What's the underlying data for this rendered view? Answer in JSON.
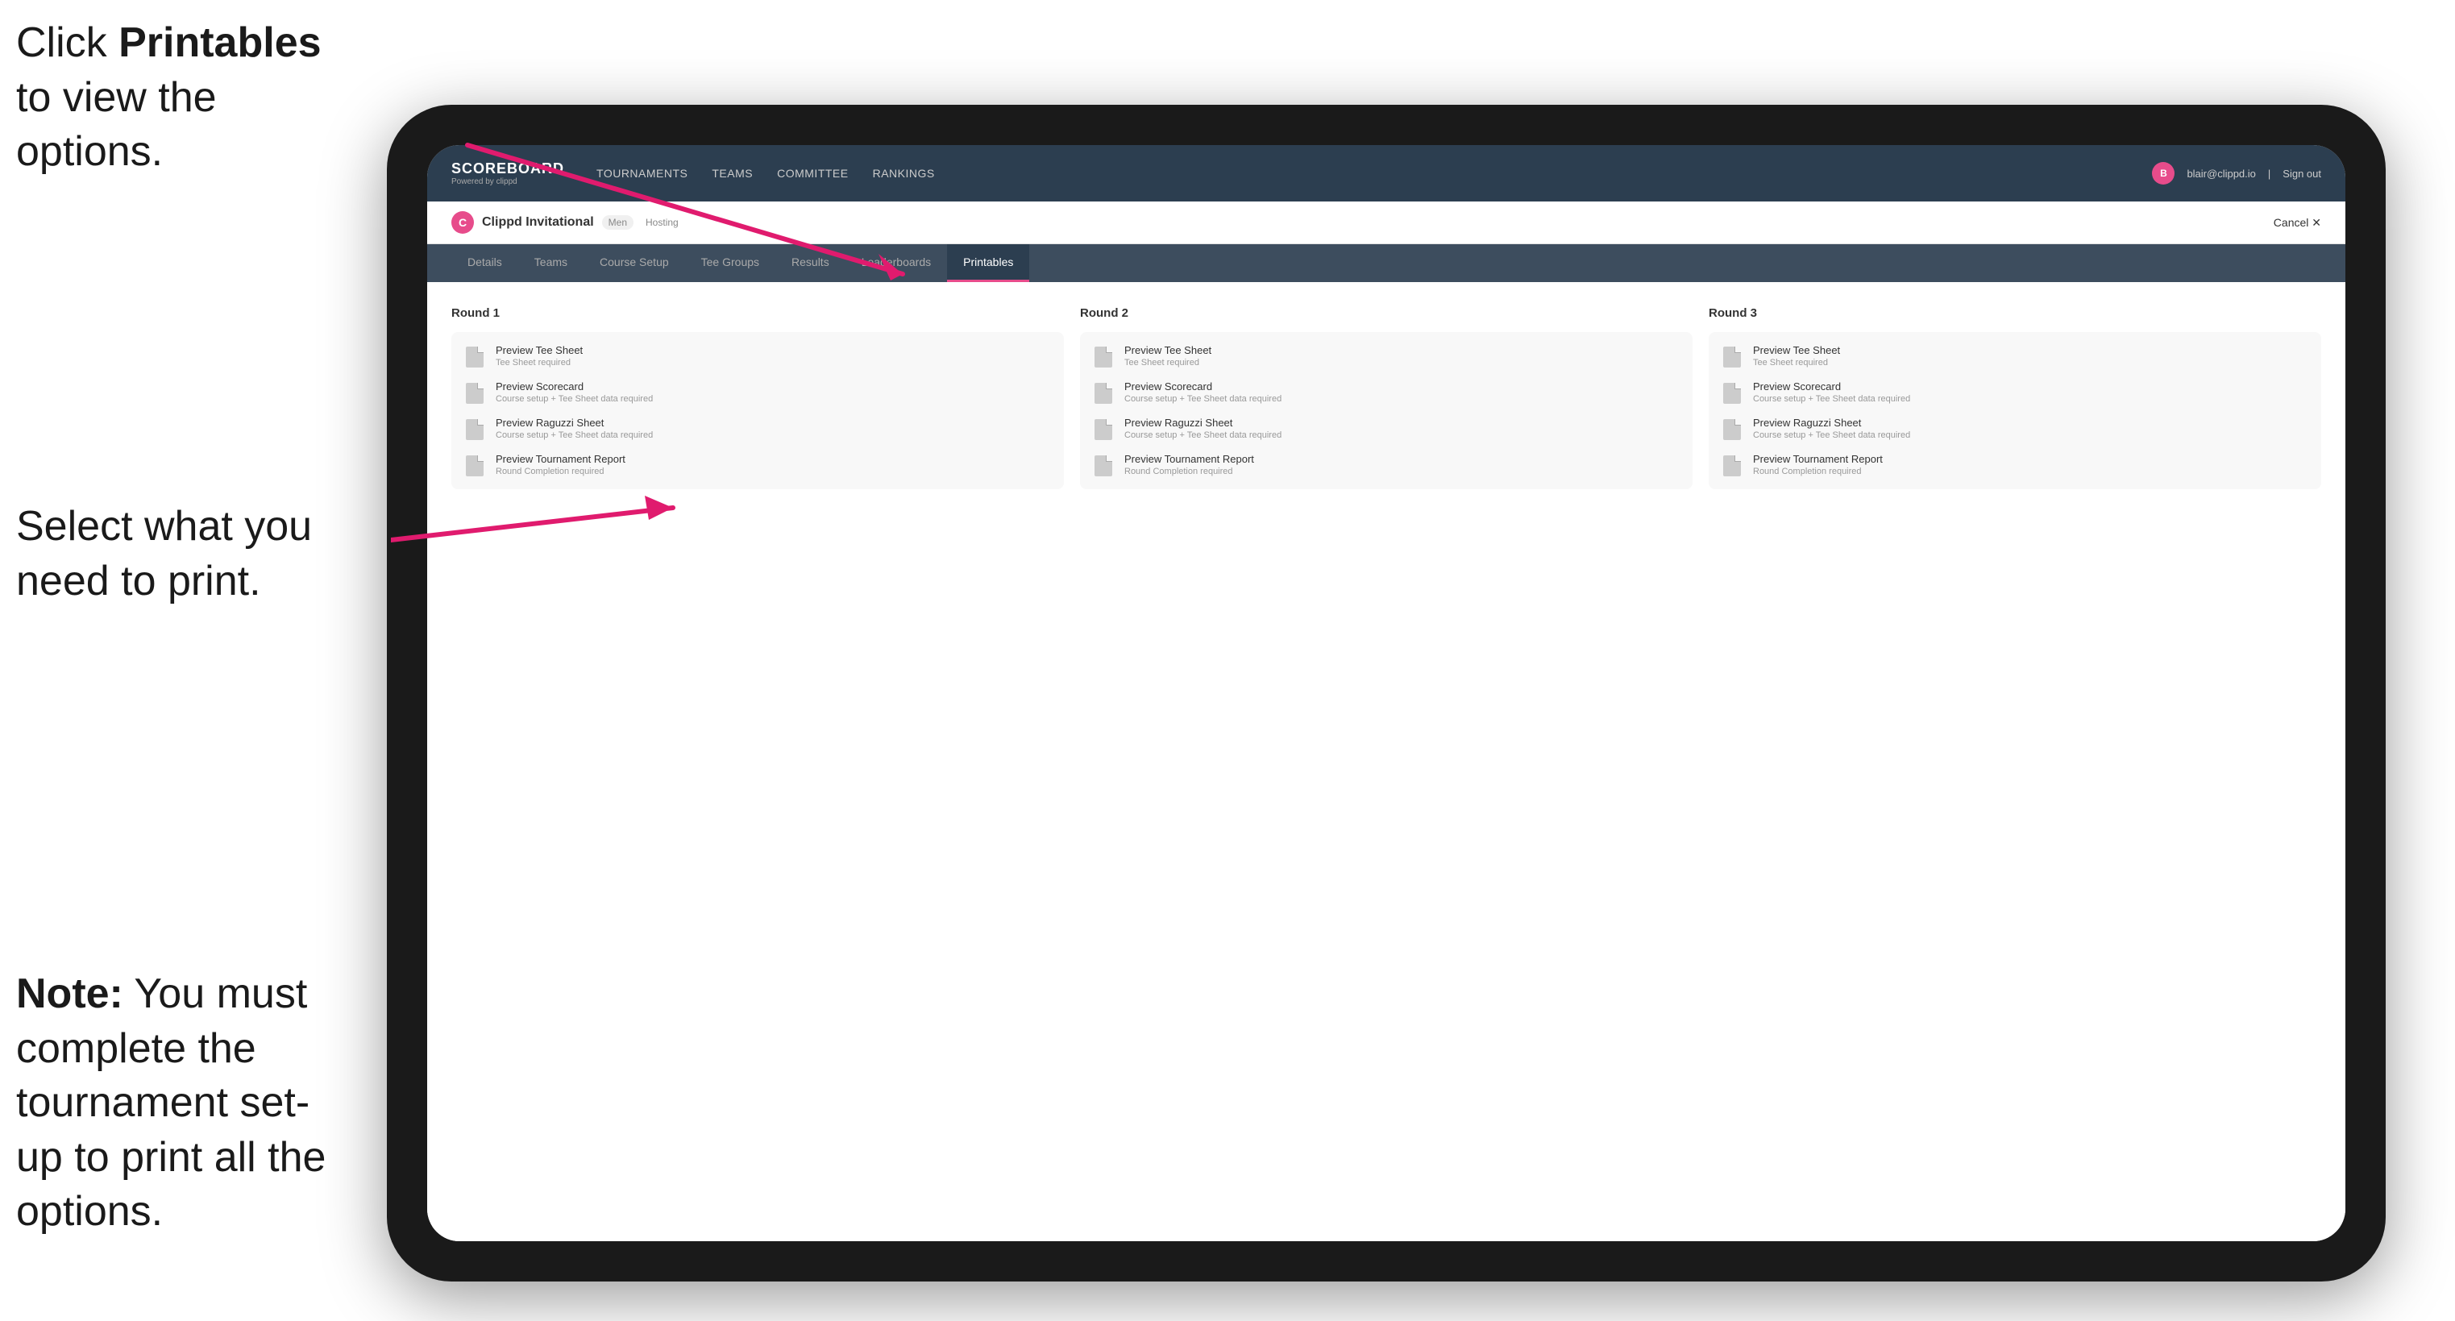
{
  "annotations": {
    "top_instruction_prefix": "Click ",
    "top_instruction_bold": "Printables",
    "top_instruction_suffix": " to view the options.",
    "mid_instruction": "Select what you need to print.",
    "bottom_note_bold": "Note:",
    "bottom_note_text": " You must complete the tournament set-up to print all the options."
  },
  "nav": {
    "logo_title": "SCOREBOARD",
    "logo_subtitle": "Powered by clippd",
    "items": [
      {
        "label": "TOURNAMENTS",
        "active": false
      },
      {
        "label": "TEAMS",
        "active": false
      },
      {
        "label": "COMMITTEE",
        "active": false
      },
      {
        "label": "RANKINGS",
        "active": false
      }
    ],
    "user_email": "blair@clippd.io",
    "sign_out": "Sign out"
  },
  "sub_header": {
    "tournament_name": "Clippd Invitational",
    "tournament_tag": "Men",
    "hosting_tag": "Hosting",
    "cancel_label": "Cancel ✕"
  },
  "tabs": [
    {
      "label": "Details",
      "active": false
    },
    {
      "label": "Teams",
      "active": false
    },
    {
      "label": "Course Setup",
      "active": false
    },
    {
      "label": "Tee Groups",
      "active": false
    },
    {
      "label": "Results",
      "active": false
    },
    {
      "label": "Leaderboards",
      "active": false
    },
    {
      "label": "Printables",
      "active": true
    }
  ],
  "rounds": [
    {
      "title": "Round 1",
      "items": [
        {
          "title": "Preview Tee Sheet",
          "subtitle": "Tee Sheet required"
        },
        {
          "title": "Preview Scorecard",
          "subtitle": "Course setup + Tee Sheet data required"
        },
        {
          "title": "Preview Raguzzi Sheet",
          "subtitle": "Course setup + Tee Sheet data required"
        },
        {
          "title": "Preview Tournament Report",
          "subtitle": "Round Completion required"
        }
      ]
    },
    {
      "title": "Round 2",
      "items": [
        {
          "title": "Preview Tee Sheet",
          "subtitle": "Tee Sheet required"
        },
        {
          "title": "Preview Scorecard",
          "subtitle": "Course setup + Tee Sheet data required"
        },
        {
          "title": "Preview Raguzzi Sheet",
          "subtitle": "Course setup + Tee Sheet data required"
        },
        {
          "title": "Preview Tournament Report",
          "subtitle": "Round Completion required"
        }
      ]
    },
    {
      "title": "Round 3",
      "items": [
        {
          "title": "Preview Tee Sheet",
          "subtitle": "Tee Sheet required"
        },
        {
          "title": "Preview Scorecard",
          "subtitle": "Course setup + Tee Sheet data required"
        },
        {
          "title": "Preview Raguzzi Sheet",
          "subtitle": "Course setup + Tee Sheet data required"
        },
        {
          "title": "Preview Tournament Report",
          "subtitle": "Round Completion required"
        }
      ]
    }
  ]
}
